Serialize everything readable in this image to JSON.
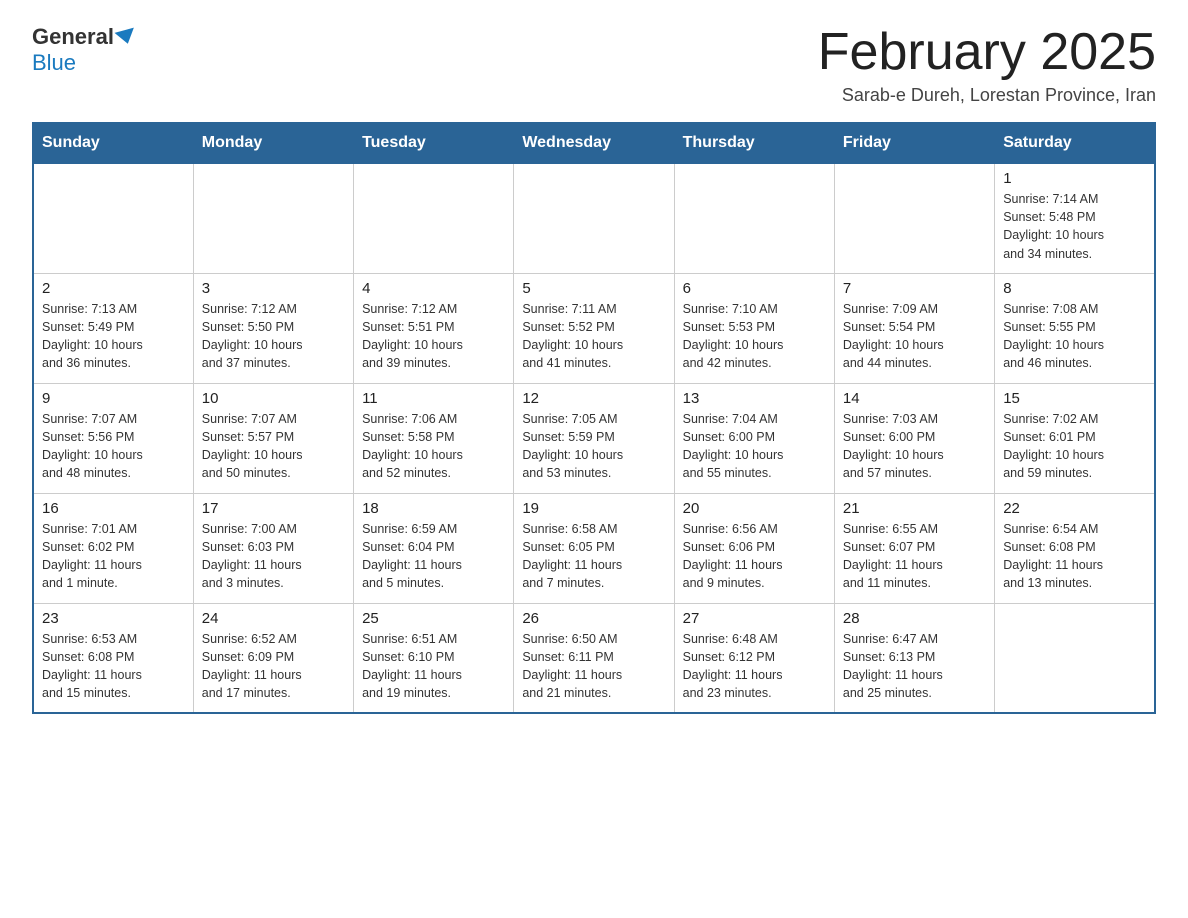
{
  "header": {
    "logo": {
      "general": "General",
      "blue": "Blue"
    },
    "title": "February 2025",
    "subtitle": "Sarab-e Dureh, Lorestan Province, Iran"
  },
  "days_of_week": [
    "Sunday",
    "Monday",
    "Tuesday",
    "Wednesday",
    "Thursday",
    "Friday",
    "Saturday"
  ],
  "weeks": [
    [
      {
        "day": "",
        "info": ""
      },
      {
        "day": "",
        "info": ""
      },
      {
        "day": "",
        "info": ""
      },
      {
        "day": "",
        "info": ""
      },
      {
        "day": "",
        "info": ""
      },
      {
        "day": "",
        "info": ""
      },
      {
        "day": "1",
        "info": "Sunrise: 7:14 AM\nSunset: 5:48 PM\nDaylight: 10 hours\nand 34 minutes."
      }
    ],
    [
      {
        "day": "2",
        "info": "Sunrise: 7:13 AM\nSunset: 5:49 PM\nDaylight: 10 hours\nand 36 minutes."
      },
      {
        "day": "3",
        "info": "Sunrise: 7:12 AM\nSunset: 5:50 PM\nDaylight: 10 hours\nand 37 minutes."
      },
      {
        "day": "4",
        "info": "Sunrise: 7:12 AM\nSunset: 5:51 PM\nDaylight: 10 hours\nand 39 minutes."
      },
      {
        "day": "5",
        "info": "Sunrise: 7:11 AM\nSunset: 5:52 PM\nDaylight: 10 hours\nand 41 minutes."
      },
      {
        "day": "6",
        "info": "Sunrise: 7:10 AM\nSunset: 5:53 PM\nDaylight: 10 hours\nand 42 minutes."
      },
      {
        "day": "7",
        "info": "Sunrise: 7:09 AM\nSunset: 5:54 PM\nDaylight: 10 hours\nand 44 minutes."
      },
      {
        "day": "8",
        "info": "Sunrise: 7:08 AM\nSunset: 5:55 PM\nDaylight: 10 hours\nand 46 minutes."
      }
    ],
    [
      {
        "day": "9",
        "info": "Sunrise: 7:07 AM\nSunset: 5:56 PM\nDaylight: 10 hours\nand 48 minutes."
      },
      {
        "day": "10",
        "info": "Sunrise: 7:07 AM\nSunset: 5:57 PM\nDaylight: 10 hours\nand 50 minutes."
      },
      {
        "day": "11",
        "info": "Sunrise: 7:06 AM\nSunset: 5:58 PM\nDaylight: 10 hours\nand 52 minutes."
      },
      {
        "day": "12",
        "info": "Sunrise: 7:05 AM\nSunset: 5:59 PM\nDaylight: 10 hours\nand 53 minutes."
      },
      {
        "day": "13",
        "info": "Sunrise: 7:04 AM\nSunset: 6:00 PM\nDaylight: 10 hours\nand 55 minutes."
      },
      {
        "day": "14",
        "info": "Sunrise: 7:03 AM\nSunset: 6:00 PM\nDaylight: 10 hours\nand 57 minutes."
      },
      {
        "day": "15",
        "info": "Sunrise: 7:02 AM\nSunset: 6:01 PM\nDaylight: 10 hours\nand 59 minutes."
      }
    ],
    [
      {
        "day": "16",
        "info": "Sunrise: 7:01 AM\nSunset: 6:02 PM\nDaylight: 11 hours\nand 1 minute."
      },
      {
        "day": "17",
        "info": "Sunrise: 7:00 AM\nSunset: 6:03 PM\nDaylight: 11 hours\nand 3 minutes."
      },
      {
        "day": "18",
        "info": "Sunrise: 6:59 AM\nSunset: 6:04 PM\nDaylight: 11 hours\nand 5 minutes."
      },
      {
        "day": "19",
        "info": "Sunrise: 6:58 AM\nSunset: 6:05 PM\nDaylight: 11 hours\nand 7 minutes."
      },
      {
        "day": "20",
        "info": "Sunrise: 6:56 AM\nSunset: 6:06 PM\nDaylight: 11 hours\nand 9 minutes."
      },
      {
        "day": "21",
        "info": "Sunrise: 6:55 AM\nSunset: 6:07 PM\nDaylight: 11 hours\nand 11 minutes."
      },
      {
        "day": "22",
        "info": "Sunrise: 6:54 AM\nSunset: 6:08 PM\nDaylight: 11 hours\nand 13 minutes."
      }
    ],
    [
      {
        "day": "23",
        "info": "Sunrise: 6:53 AM\nSunset: 6:08 PM\nDaylight: 11 hours\nand 15 minutes."
      },
      {
        "day": "24",
        "info": "Sunrise: 6:52 AM\nSunset: 6:09 PM\nDaylight: 11 hours\nand 17 minutes."
      },
      {
        "day": "25",
        "info": "Sunrise: 6:51 AM\nSunset: 6:10 PM\nDaylight: 11 hours\nand 19 minutes."
      },
      {
        "day": "26",
        "info": "Sunrise: 6:50 AM\nSunset: 6:11 PM\nDaylight: 11 hours\nand 21 minutes."
      },
      {
        "day": "27",
        "info": "Sunrise: 6:48 AM\nSunset: 6:12 PM\nDaylight: 11 hours\nand 23 minutes."
      },
      {
        "day": "28",
        "info": "Sunrise: 6:47 AM\nSunset: 6:13 PM\nDaylight: 11 hours\nand 25 minutes."
      },
      {
        "day": "",
        "info": ""
      }
    ]
  ]
}
